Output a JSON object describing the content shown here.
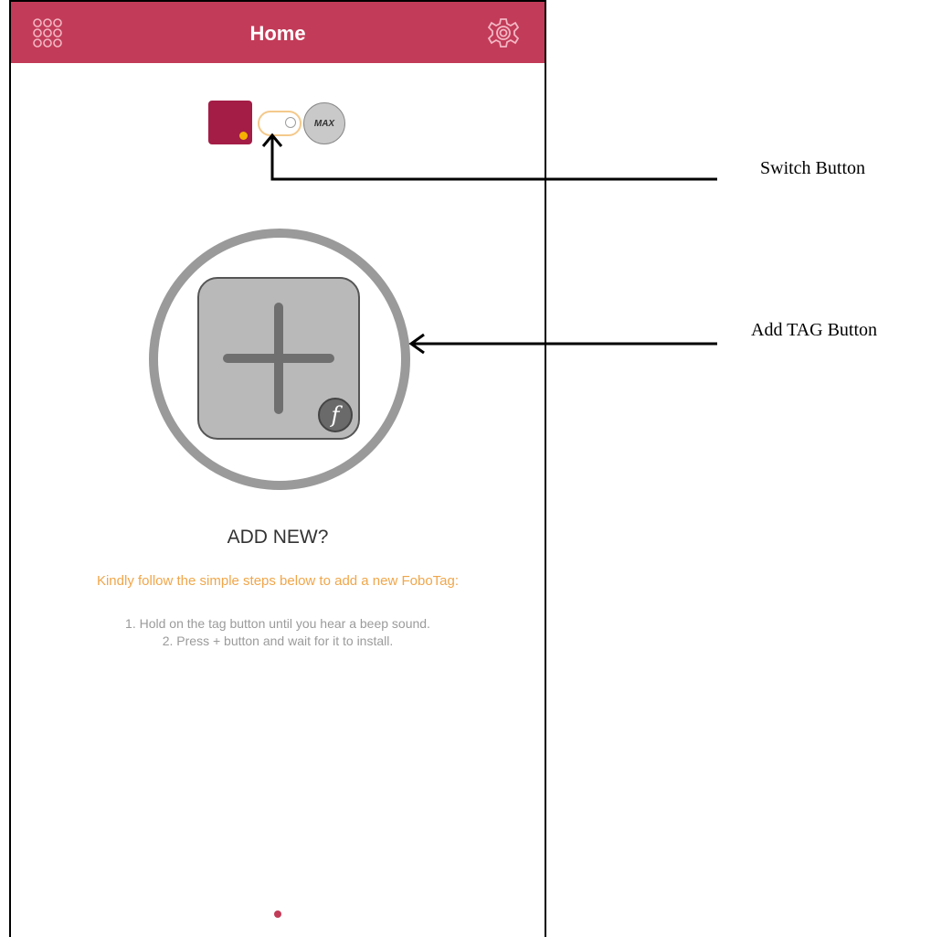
{
  "header": {
    "title": "Home",
    "background_color": "#c23b58",
    "left_icon": "grid-menu-icon",
    "right_icon": "gear-icon"
  },
  "tag_selector": {
    "left_tag_color": "#a31d47",
    "right_tag_label": "MAX"
  },
  "add_tag": {
    "title": "ADD NEW?",
    "instruction": "Kindly follow the simple steps below to add a new FoboTag:",
    "steps": [
      "1. Hold on the tag button until you hear a beep sound.",
      "2. Press + button and wait for it to install."
    ],
    "badge_letter": "f",
    "instruction_color": "#f0a64a"
  },
  "pager": {
    "active_color": "#c23b58"
  },
  "annotations": {
    "switch_button": "Switch Button",
    "add_tag_button": "Add TAG Button"
  }
}
